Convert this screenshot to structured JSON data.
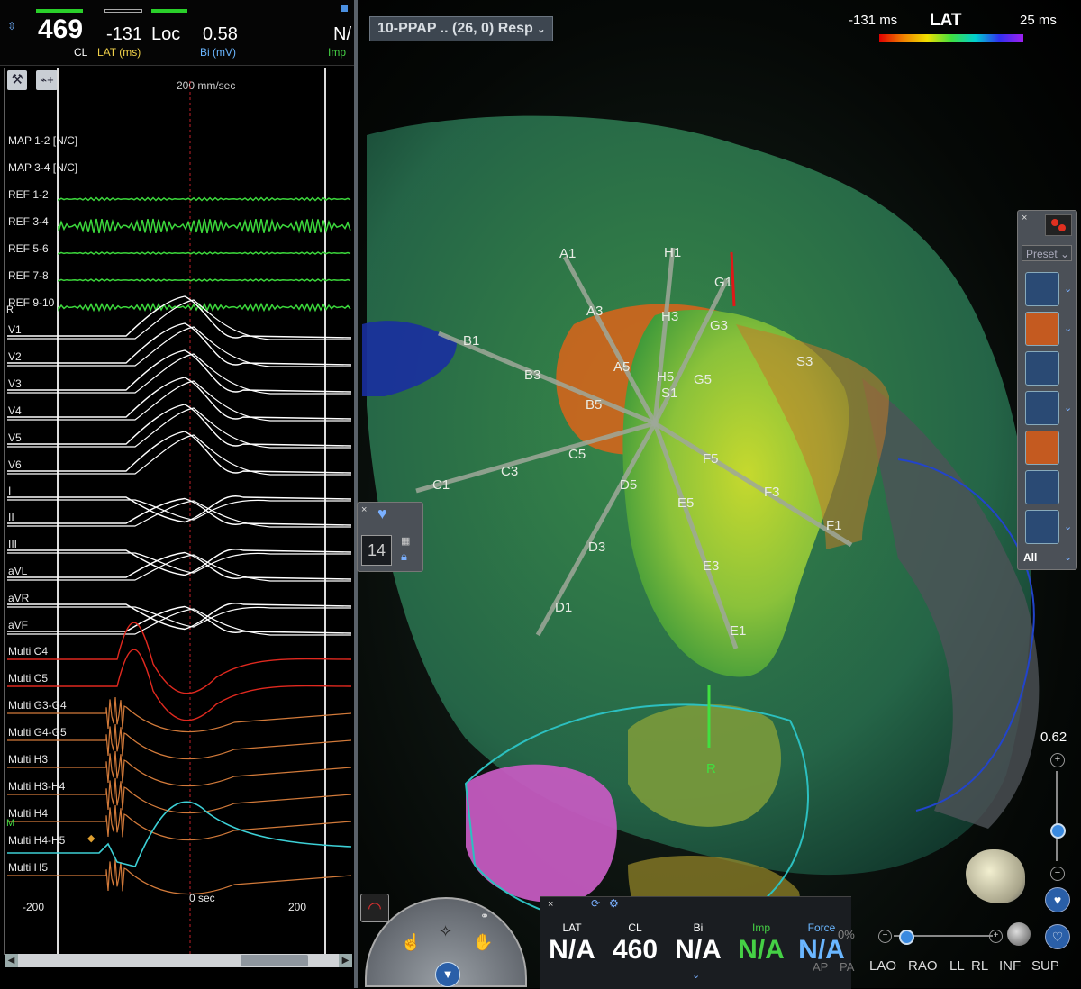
{
  "status_bar": {
    "cl_value": "469",
    "cl_label": "CL",
    "lat_value": "-131",
    "lat_label": "LAT (ms)",
    "loc_label": "Loc",
    "bi_value": "0.58",
    "bi_label": "Bi (mV)",
    "imp_value": "N/",
    "imp_label": "Imp"
  },
  "signals": {
    "speed": "200 mm/sec",
    "time_zero": "0 sec",
    "time_min": "-200",
    "time_max": "200",
    "channels": [
      "MAP 1-2 [N/C]",
      "MAP 3-4 [N/C]",
      "REF 1-2",
      "REF 3-4",
      "REF 5-6",
      "REF 7-8",
      "REF 9-10",
      "V1",
      "V2",
      "V3",
      "V4",
      "V5",
      "V6",
      "I",
      "II",
      "III",
      "aVL",
      "aVR",
      "aVF",
      "Multi  C4",
      "Multi  C5",
      "Multi  G3-G4",
      "Multi  G4-G5",
      "Multi  H3",
      "Multi  H3-H4",
      "Multi  H4",
      "Multi  H4-H5",
      "Multi  H5"
    ],
    "r_marker": "R",
    "m_marker": "M"
  },
  "map": {
    "name": "10-PPAP .. (26, 0) Resp",
    "scale_min": "-131 ms",
    "scale_label": "LAT",
    "scale_max": "25 ms",
    "opacity_value": "0.62",
    "catheter_labels": [
      "A1",
      "A3",
      "A5",
      "B1",
      "B3",
      "B5",
      "C1",
      "C3",
      "C5",
      "D1",
      "D3",
      "D5",
      "E1",
      "E3",
      "E5",
      "F1",
      "F3",
      "F5",
      "G1",
      "G3",
      "G5",
      "H1",
      "H3",
      "H5",
      "S1",
      "S3",
      "R"
    ],
    "count_value": "14",
    "preset_label": "Preset",
    "all_label": "All",
    "colors": {
      "map_green": "#3a8f3a",
      "map_yellow": "#b9cf2a",
      "map_orange": "#d2651c",
      "map_pink": "#c45bc0",
      "ref_green": "#3cd83c",
      "ecg_white": "#ffffff",
      "multi_red": "#e0291f",
      "multi_orange": "#d27a3a",
      "multi_cyan": "#3dd0d6"
    }
  },
  "bottom_panel": {
    "lat_label": "LAT",
    "lat_value": "N/A",
    "cl_label": "CL",
    "cl_value": "460",
    "bi_label": "Bi",
    "bi_value": "N/A",
    "imp_label": "Imp",
    "imp_value": "N/A",
    "force_label": "Force",
    "force_value": "N/A",
    "ap_label": "AP",
    "pa_label": "PA",
    "percent": "0%"
  },
  "view_buttons": [
    "LAO",
    "RAO",
    "LL",
    "RL",
    "INF",
    "SUP"
  ]
}
